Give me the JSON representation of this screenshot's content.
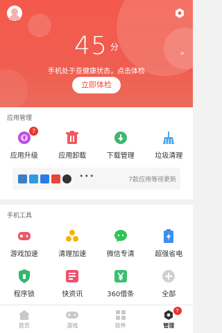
{
  "hero": {
    "score": "45",
    "score_unit": "分",
    "status_text": "手机处于亚健康状态，点击体检",
    "check_button": "立即体检",
    "arrow": "»"
  },
  "app_management": {
    "title": "应用管理",
    "items": [
      {
        "label": "应用升级",
        "icon": "upgrade-icon",
        "badge": "7"
      },
      {
        "label": "应用卸载",
        "icon": "trash-icon"
      },
      {
        "label": "下载管理",
        "icon": "download-icon"
      },
      {
        "label": "垃圾清理",
        "icon": "broom-icon"
      }
    ],
    "pending": {
      "more": "•••",
      "text": "7款应用等待更新"
    }
  },
  "phone_tools": {
    "title": "手机工具",
    "items": [
      {
        "label": "游戏加速",
        "icon": "game-icon"
      },
      {
        "label": "清理加速",
        "icon": "fan-icon"
      },
      {
        "label": "微信专清",
        "icon": "wechat-icon"
      },
      {
        "label": "超强省电",
        "icon": "battery-icon"
      },
      {
        "label": "程序锁",
        "icon": "lock-icon"
      },
      {
        "label": "快资讯",
        "icon": "news-icon"
      },
      {
        "label": "360借条",
        "icon": "360-loan-icon"
      },
      {
        "label": "全部",
        "icon": "plus-icon"
      }
    ]
  },
  "tabbar": {
    "items": [
      {
        "label": "首页"
      },
      {
        "label": "游戏"
      },
      {
        "label": "软件"
      },
      {
        "label": "管理",
        "badge": "7"
      }
    ]
  },
  "colors": {
    "accent": "#f04c3e",
    "badge": "#e5382f"
  }
}
